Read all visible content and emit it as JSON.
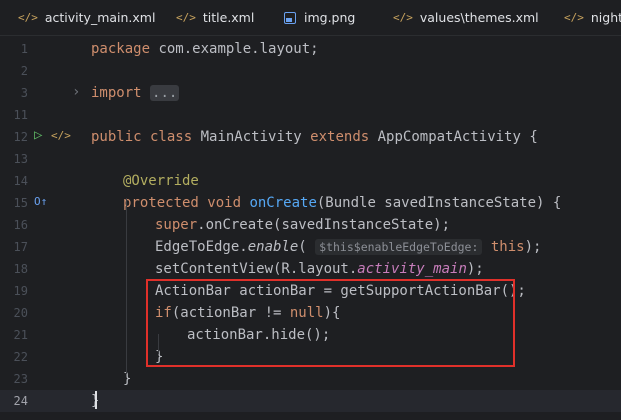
{
  "tabs": [
    {
      "label": "activity_main.xml",
      "icon": "xml-icon"
    },
    {
      "label": "title.xml",
      "icon": "xml-icon"
    },
    {
      "label": "img.png",
      "icon": "image-icon"
    },
    {
      "label": "values\\themes.xml",
      "icon": "xml-icon"
    },
    {
      "label": "night\\t",
      "icon": "xml-icon"
    }
  ],
  "tab_icon_glyph": "</>",
  "lines": [
    {
      "num": "1"
    },
    {
      "num": "2"
    },
    {
      "num": "3"
    },
    {
      "num": "11"
    },
    {
      "num": "12"
    },
    {
      "num": "13"
    },
    {
      "num": "14"
    },
    {
      "num": "15"
    },
    {
      "num": "16"
    },
    {
      "num": "17"
    },
    {
      "num": "18"
    },
    {
      "num": "19"
    },
    {
      "num": "20"
    },
    {
      "num": "21"
    },
    {
      "num": "22"
    },
    {
      "num": "23"
    },
    {
      "num": "24"
    }
  ],
  "code": {
    "l1a": "package",
    "l1b": " com.example.layout;",
    "l3a": "import",
    "l3fold": "...",
    "l12a": "public class",
    "l12b": " MainActivity ",
    "l12c": "extends",
    "l12d": " AppCompatActivity {",
    "l15ann": "@Override",
    "l15a": "protected void",
    "l15fn": " onCreate",
    "l15b": "(Bundle savedInstanceState) {",
    "l16a": "super",
    "l16b": ".onCreate(savedInstanceState);",
    "l17a": "EdgeToEdge.",
    "l17fn": "enable",
    "l17b": "( ",
    "l17hint": "$this$enableEdgeToEdge:",
    "l17c": " this",
    "l17d": ");",
    "l18a": "setContentView(R.layout.",
    "l18p": "activity_main",
    "l18b": ");",
    "l19": "ActionBar actionBar = getSupportActionBar();",
    "l20a": "if",
    "l20b": "(actionBar != ",
    "l20c": "null",
    "l20d": "){",
    "l21": "actionBar.hide();",
    "l22": "}",
    "l23": "}",
    "l24": "}"
  },
  "gutter_markers": {
    "run": "▷",
    "code": "</>",
    "override": "O↑",
    "chevron": "›"
  },
  "colors": {
    "bg": "#1e1f22",
    "keyword": "#cf8e6d",
    "function": "#56a8f5",
    "annotation": "#b3ae60",
    "highlight_box": "#e0302a"
  }
}
